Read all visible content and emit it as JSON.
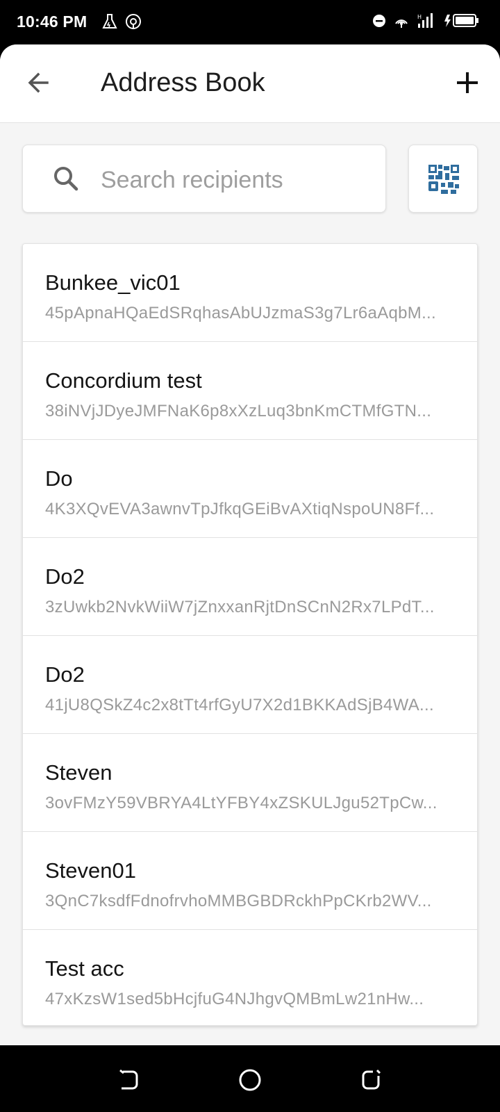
{
  "status_bar": {
    "time": "10:46 PM",
    "icons": [
      "lab-flask-icon",
      "hotspot-icon",
      "do-not-disturb-icon",
      "wifi-hotspot-icon",
      "signal-icon",
      "battery-charging-icon"
    ]
  },
  "header": {
    "title": "Address Book",
    "back_icon": "arrow-back-icon",
    "add_icon": "plus-icon"
  },
  "search": {
    "placeholder": "Search recipients",
    "value": "",
    "icon": "search-icon",
    "qr_icon": "qr-code-scan-icon"
  },
  "recipients": [
    {
      "name": "Bunkee_vic01",
      "address": "45pApnaHQaEdSRqhasAbUJzmaS3g7Lr6aAqbM..."
    },
    {
      "name": "Concordium test",
      "address": "38iNVjJDyeJMFNaK6p8xXzLuq3bnKmCTMfGTN..."
    },
    {
      "name": "Do",
      "address": "4K3XQvEVA3awnvTpJfkqGEiBvAXtiqNspoUN8Ff..."
    },
    {
      "name": "Do2",
      "address": "3zUwkb2NvkWiiW7jZnxxanRjtDnSCnN2Rx7LPdT..."
    },
    {
      "name": "Do2",
      "address": "41jU8QSkZ4c2x8tTt4rfGyU7X2d1BKKAdSjB4WA..."
    },
    {
      "name": "Steven",
      "address": "3ovFMzY59VBRYA4LtYFBY4xZSKULJgu52TpCw..."
    },
    {
      "name": "Steven01",
      "address": "3QnC7ksdfFdnofrvhoMMBGBDRckhPpCKrb2WV..."
    },
    {
      "name": "Test acc",
      "address": "47xKzsW1sed5bHcjfuG4NJhgvQMBmLw21nHw..."
    }
  ],
  "nav_bar": {
    "icons": [
      "back-gesture-icon",
      "home-circle-icon",
      "recents-icon"
    ]
  },
  "colors": {
    "accent": "#2f6d9e",
    "background": "#f5f5f5",
    "card": "#ffffff",
    "text_primary": "#141414",
    "text_secondary": "#9a9a9a"
  }
}
